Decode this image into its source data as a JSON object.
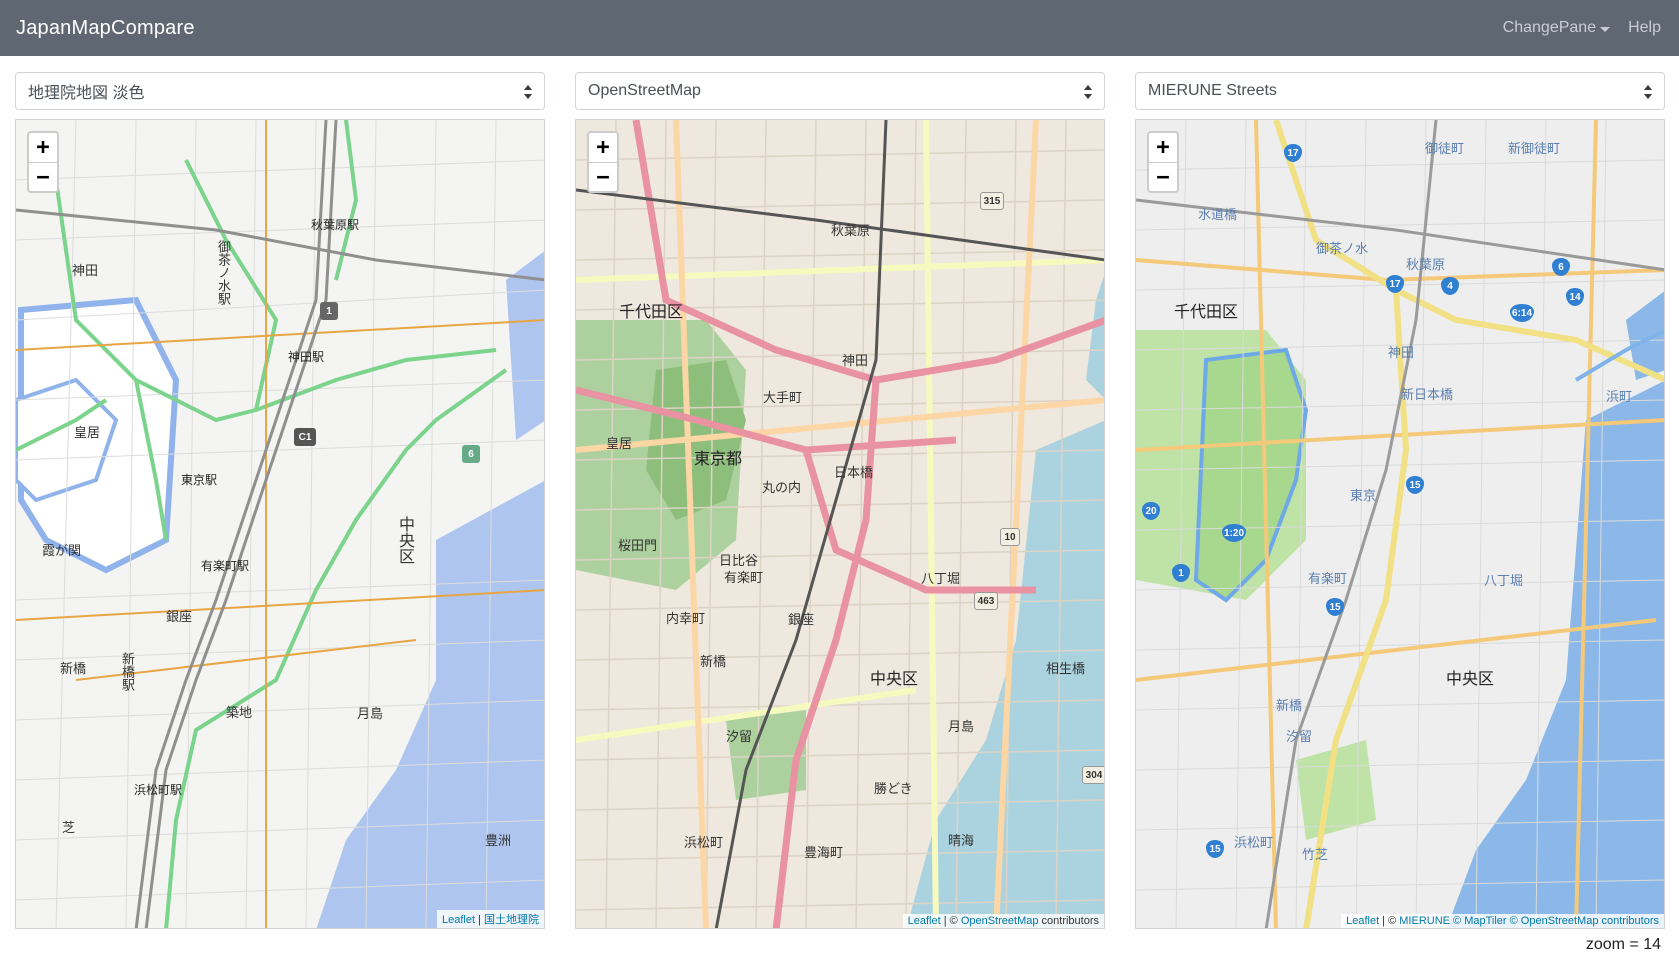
{
  "app": {
    "brand": "JapanMapCompare"
  },
  "nav": {
    "change_pane": "ChangePane",
    "help": "Help"
  },
  "panes": [
    {
      "selected_layer": "地理院地図 淡色",
      "attribution": {
        "leaflet": "Leaflet",
        "sep": " | ",
        "source": "国土地理院",
        "suffix": ""
      },
      "labels": [
        "秋葉原駅",
        "神田",
        "御茶ノ水駅",
        "神田駅",
        "皇居",
        "東京駅",
        "霞が関",
        "有楽町駅",
        "銀座",
        "中央区",
        "新橋",
        "新橋駅",
        "築地",
        "月島",
        "浜松町駅",
        "芝",
        "豊洲"
      ],
      "shields": [
        "1",
        "C1",
        "6"
      ]
    },
    {
      "selected_layer": "OpenStreetMap",
      "attribution": {
        "leaflet": "Leaflet",
        "sep": " | © ",
        "source": "OpenStreetMap",
        "suffix": " contributors"
      },
      "labels": [
        "千代田区",
        "東京都",
        "皇居",
        "秋葉原",
        "神田",
        "大手町",
        "丸の内",
        "日本橋",
        "有楽町",
        "銀座",
        "中央区",
        "新橋",
        "月島",
        "勝どき",
        "晴海",
        "豊海町",
        "浜松町",
        "汐留",
        "八丁堀",
        "相生橋",
        "日比谷",
        "桜田門",
        "内幸町"
      ],
      "shields": [
        "315",
        "10",
        "463",
        "304"
      ]
    },
    {
      "selected_layer": "MIERUNE Streets",
      "attribution": {
        "leaflet": "Leaflet",
        "sep": " | © ",
        "source": "MIERUNE © MapTiler © OpenStreetMap contributors",
        "suffix": ""
      },
      "labels": [
        "千代田区",
        "中央区",
        "水道橋",
        "御茶ノ水",
        "秋葉原",
        "新日本橋",
        "東京",
        "有楽町",
        "新橋",
        "汐留",
        "浜松町",
        "八丁堀",
        "御徒町",
        "新御徒町",
        "浜町",
        "竹芝",
        "神田"
      ],
      "shields": [
        "17",
        "17",
        "4",
        "6",
        "14",
        "6:14",
        "15",
        "20",
        "1:20",
        "1",
        "15",
        "15"
      ]
    }
  ],
  "status": {
    "zoom": "zoom = 14"
  }
}
